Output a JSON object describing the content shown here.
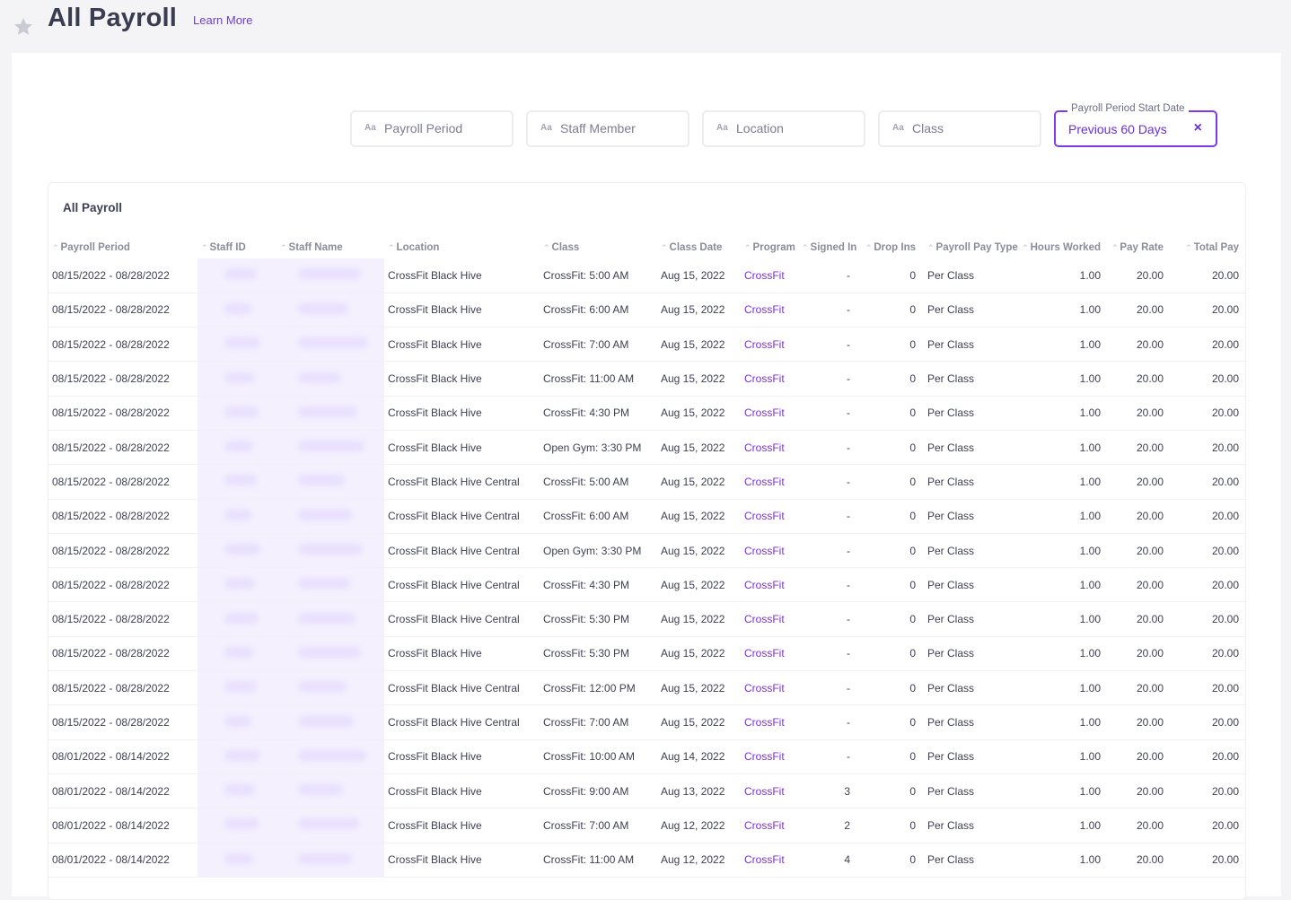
{
  "header": {
    "title": "All Payroll",
    "learn_more": "Learn More"
  },
  "filters": [
    {
      "prefix": "Aa",
      "placeholder": "Payroll Period"
    },
    {
      "prefix": "Aa",
      "placeholder": "Staff Member"
    },
    {
      "prefix": "Aa",
      "placeholder": "Location"
    },
    {
      "prefix": "Aa",
      "placeholder": "Class"
    }
  ],
  "active_filter": {
    "label": "Payroll Period Start Date",
    "value": "Previous 60 Days",
    "clear": "×"
  },
  "panel": {
    "title": "All Payroll"
  },
  "columns": [
    "Payroll Period",
    "Staff ID",
    "Staff Name",
    "Location",
    "Class",
    "Class Date",
    "Program",
    "Signed In",
    "Drop Ins",
    "Payroll Pay Type",
    "Hours Worked",
    "Pay Rate",
    "Total Pay"
  ],
  "rows": [
    [
      "08/15/2022 - 08/28/2022",
      "",
      "",
      "CrossFit Black Hive",
      "CrossFit: 5:00 AM",
      "Aug 15, 2022",
      "CrossFit",
      "-",
      "0",
      "Per Class",
      "1.00",
      "20.00",
      "20.00"
    ],
    [
      "08/15/2022 - 08/28/2022",
      "",
      "",
      "CrossFit Black Hive",
      "CrossFit: 6:00 AM",
      "Aug 15, 2022",
      "CrossFit",
      "-",
      "0",
      "Per Class",
      "1.00",
      "20.00",
      "20.00"
    ],
    [
      "08/15/2022 - 08/28/2022",
      "",
      "",
      "CrossFit Black Hive",
      "CrossFit: 7:00 AM",
      "Aug 15, 2022",
      "CrossFit",
      "-",
      "0",
      "Per Class",
      "1.00",
      "20.00",
      "20.00"
    ],
    [
      "08/15/2022 - 08/28/2022",
      "",
      "",
      "CrossFit Black Hive",
      "CrossFit: 11:00 AM",
      "Aug 15, 2022",
      "CrossFit",
      "-",
      "0",
      "Per Class",
      "1.00",
      "20.00",
      "20.00"
    ],
    [
      "08/15/2022 - 08/28/2022",
      "",
      "",
      "CrossFit Black Hive",
      "CrossFit: 4:30 PM",
      "Aug 15, 2022",
      "CrossFit",
      "-",
      "0",
      "Per Class",
      "1.00",
      "20.00",
      "20.00"
    ],
    [
      "08/15/2022 - 08/28/2022",
      "",
      "",
      "CrossFit Black Hive",
      "Open Gym: 3:30 PM",
      "Aug 15, 2022",
      "CrossFit",
      "-",
      "0",
      "Per Class",
      "1.00",
      "20.00",
      "20.00"
    ],
    [
      "08/15/2022 - 08/28/2022",
      "",
      "",
      "CrossFit Black Hive Central",
      "CrossFit: 5:00 AM",
      "Aug 15, 2022",
      "CrossFit",
      "-",
      "0",
      "Per Class",
      "1.00",
      "20.00",
      "20.00"
    ],
    [
      "08/15/2022 - 08/28/2022",
      "",
      "",
      "CrossFit Black Hive Central",
      "CrossFit: 6:00 AM",
      "Aug 15, 2022",
      "CrossFit",
      "-",
      "0",
      "Per Class",
      "1.00",
      "20.00",
      "20.00"
    ],
    [
      "08/15/2022 - 08/28/2022",
      "",
      "",
      "CrossFit Black Hive Central",
      "Open Gym: 3:30 PM",
      "Aug 15, 2022",
      "CrossFit",
      "-",
      "0",
      "Per Class",
      "1.00",
      "20.00",
      "20.00"
    ],
    [
      "08/15/2022 - 08/28/2022",
      "",
      "",
      "CrossFit Black Hive Central",
      "CrossFit: 4:30 PM",
      "Aug 15, 2022",
      "CrossFit",
      "-",
      "0",
      "Per Class",
      "1.00",
      "20.00",
      "20.00"
    ],
    [
      "08/15/2022 - 08/28/2022",
      "",
      "",
      "CrossFit Black Hive Central",
      "CrossFit: 5:30 PM",
      "Aug 15, 2022",
      "CrossFit",
      "-",
      "0",
      "Per Class",
      "1.00",
      "20.00",
      "20.00"
    ],
    [
      "08/15/2022 - 08/28/2022",
      "",
      "",
      "CrossFit Black Hive",
      "CrossFit: 5:30 PM",
      "Aug 15, 2022",
      "CrossFit",
      "-",
      "0",
      "Per Class",
      "1.00",
      "20.00",
      "20.00"
    ],
    [
      "08/15/2022 - 08/28/2022",
      "",
      "",
      "CrossFit Black Hive Central",
      "CrossFit: 12:00 PM",
      "Aug 15, 2022",
      "CrossFit",
      "-",
      "0",
      "Per Class",
      "1.00",
      "20.00",
      "20.00"
    ],
    [
      "08/15/2022 - 08/28/2022",
      "",
      "",
      "CrossFit Black Hive Central",
      "CrossFit: 7:00 AM",
      "Aug 15, 2022",
      "CrossFit",
      "-",
      "0",
      "Per Class",
      "1.00",
      "20.00",
      "20.00"
    ],
    [
      "08/01/2022 - 08/14/2022",
      "",
      "",
      "CrossFit Black Hive",
      "CrossFit: 10:00 AM",
      "Aug 14, 2022",
      "CrossFit",
      "-",
      "0",
      "Per Class",
      "1.00",
      "20.00",
      "20.00"
    ],
    [
      "08/01/2022 - 08/14/2022",
      "",
      "",
      "CrossFit Black Hive",
      "CrossFit: 9:00 AM",
      "Aug 13, 2022",
      "CrossFit",
      "3",
      "0",
      "Per Class",
      "1.00",
      "20.00",
      "20.00"
    ],
    [
      "08/01/2022 - 08/14/2022",
      "",
      "",
      "CrossFit Black Hive",
      "CrossFit: 7:00 AM",
      "Aug 12, 2022",
      "CrossFit",
      "2",
      "0",
      "Per Class",
      "1.00",
      "20.00",
      "20.00"
    ],
    [
      "08/01/2022 - 08/14/2022",
      "",
      "",
      "CrossFit Black Hive",
      "CrossFit: 11:00 AM",
      "Aug 12, 2022",
      "CrossFit",
      "4",
      "0",
      "Per Class",
      "1.00",
      "20.00",
      "20.00"
    ]
  ],
  "colors": {
    "accent": "#7c3aed",
    "program_link": "#7c2fd6",
    "title": "#3a3c50"
  },
  "icons": {
    "favorite": "star-icon",
    "sort": "sort-icon",
    "clear": "close-icon"
  }
}
